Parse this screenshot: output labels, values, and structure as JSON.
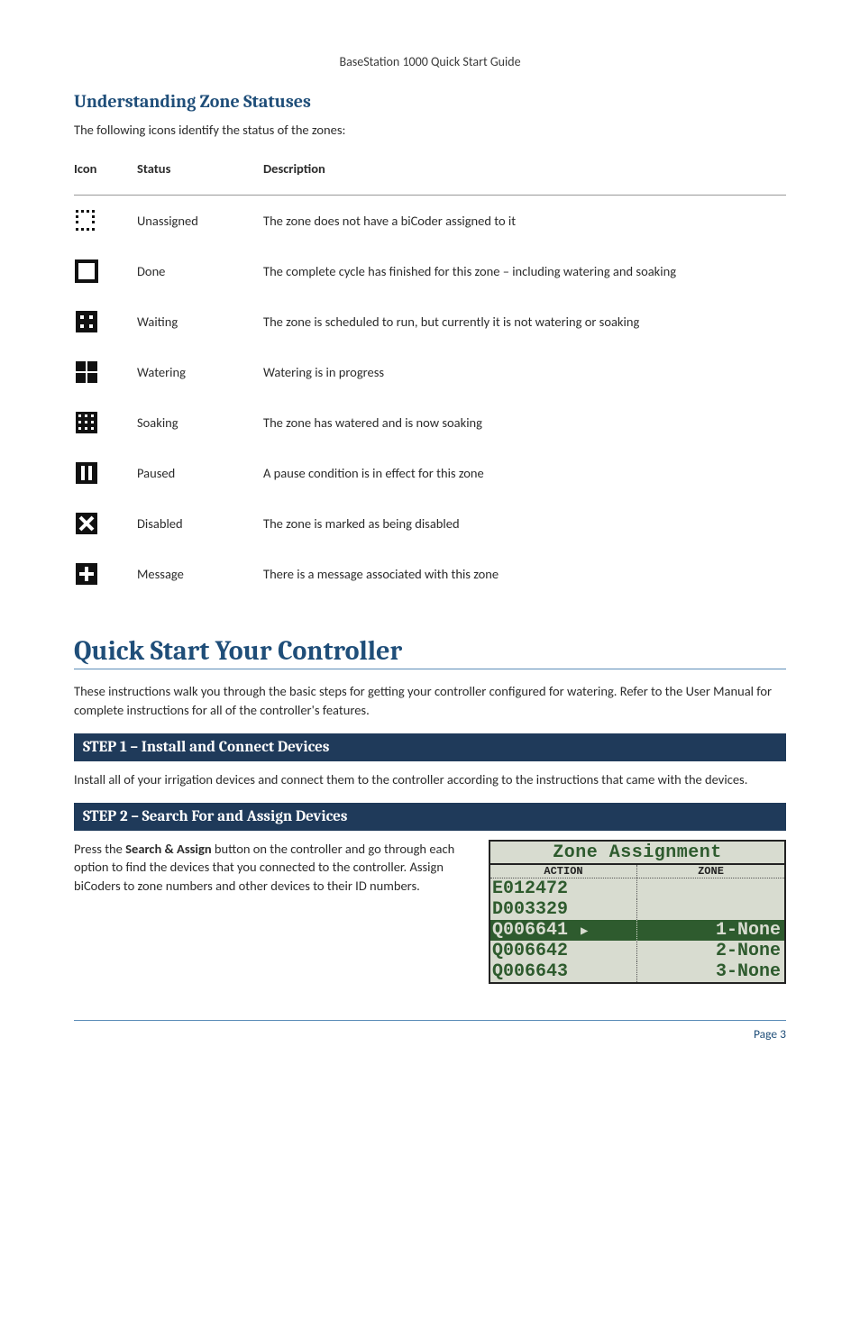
{
  "header": "BaseStation 1000 Quick Start Guide",
  "section_understanding": {
    "title": "Understanding Zone Statuses",
    "intro": "The following icons identify the status of the zones:"
  },
  "status_table": {
    "headers": {
      "icon": "Icon",
      "status": "Status",
      "description": "Description"
    },
    "rows": [
      {
        "icon": "unassigned-icon",
        "status": "Unassigned",
        "description": "The zone does not have a biCoder assigned to it"
      },
      {
        "icon": "done-icon",
        "status": "Done",
        "description": "The complete cycle has finished for this zone – including watering and soaking"
      },
      {
        "icon": "waiting-icon",
        "status": "Waiting",
        "description": "The zone is scheduled to run, but currently it is not watering or soaking"
      },
      {
        "icon": "watering-icon",
        "status": "Watering",
        "description": "Watering is in progress"
      },
      {
        "icon": "soaking-icon",
        "status": "Soaking",
        "description": "The zone has watered and is now soaking"
      },
      {
        "icon": "paused-icon",
        "status": "Paused",
        "description": "A pause condition is in effect for this zone"
      },
      {
        "icon": "disabled-icon",
        "status": "Disabled",
        "description": "The zone is marked as being disabled"
      },
      {
        "icon": "message-icon",
        "status": "Message",
        "description": "There is a message associated with this zone"
      }
    ]
  },
  "quick_start": {
    "title": "Quick Start Your Controller",
    "intro": "These instructions walk you through the basic steps for getting your controller configured for watering. Refer to the User Manual for complete instructions for all of the controller's features."
  },
  "step1": {
    "bar": "STEP 1 – Install and Connect Devices",
    "body": "Install all of your irrigation devices and connect them to the controller according to the instructions that came with the devices."
  },
  "step2": {
    "bar": "STEP 2 – Search For and Assign Devices",
    "body_pre": "Press the ",
    "body_bold": "Search & Assign",
    "body_post": " button on the controller and go through each option to find the devices that you connected to the controller. Assign biCoders to zone numbers and other devices to their ID numbers."
  },
  "lcd": {
    "title": "Zone Assignment",
    "header_action": "ACTION",
    "header_zone": "ZONE",
    "rows": [
      {
        "action": "E012472",
        "zone": "",
        "selected": false
      },
      {
        "action": "D003329",
        "zone": "",
        "selected": false
      },
      {
        "action": "Q006641",
        "zone": "1-None",
        "selected": true
      },
      {
        "action": "Q006642",
        "zone": "2-None",
        "selected": false
      },
      {
        "action": "Q006643",
        "zone": "3-None",
        "selected": false
      }
    ]
  },
  "footer": {
    "page": "Page 3"
  }
}
